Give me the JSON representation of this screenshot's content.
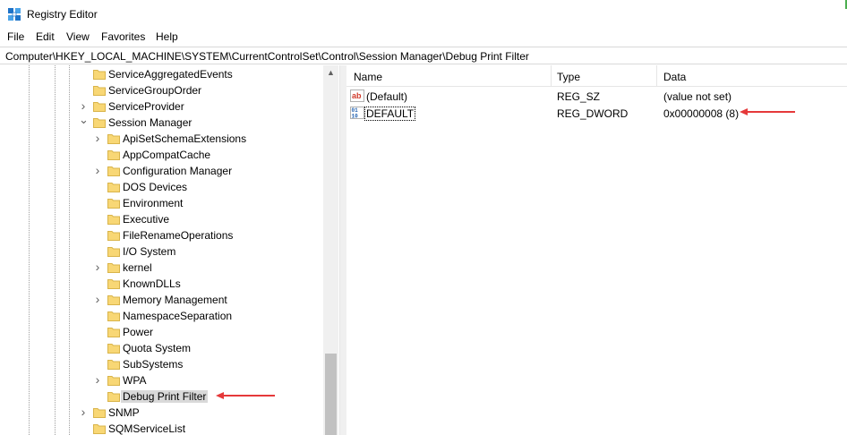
{
  "window": {
    "title": "Registry Editor"
  },
  "menu": [
    "File",
    "Edit",
    "View",
    "Favorites",
    "Help"
  ],
  "address": "Computer\\HKEY_LOCAL_MACHINE\\SYSTEM\\CurrentControlSet\\Control\\Session Manager\\Debug Print Filter",
  "tree": {
    "items": [
      {
        "label": "ServiceAggregatedEvents",
        "expander": ""
      },
      {
        "label": "ServiceGroupOrder",
        "expander": ""
      },
      {
        "label": "ServiceProvider",
        "expander": ">"
      },
      {
        "label": "Session Manager",
        "expander": "v"
      },
      {
        "label": "ApiSetSchemaExtensions",
        "expander": ">"
      },
      {
        "label": "AppCompatCache",
        "expander": ""
      },
      {
        "label": "Configuration Manager",
        "expander": ">"
      },
      {
        "label": "DOS Devices",
        "expander": ""
      },
      {
        "label": "Environment",
        "expander": ""
      },
      {
        "label": "Executive",
        "expander": ""
      },
      {
        "label": "FileRenameOperations",
        "expander": ""
      },
      {
        "label": "I/O System",
        "expander": ""
      },
      {
        "label": "kernel",
        "expander": ">"
      },
      {
        "label": "KnownDLLs",
        "expander": ""
      },
      {
        "label": "Memory Management",
        "expander": ">"
      },
      {
        "label": "NamespaceSeparation",
        "expander": ""
      },
      {
        "label": "Power",
        "expander": ""
      },
      {
        "label": "Quota System",
        "expander": ""
      },
      {
        "label": "SubSystems",
        "expander": ""
      },
      {
        "label": "WPA",
        "expander": ">"
      },
      {
        "label": "Debug Print Filter",
        "expander": "",
        "selected": true
      },
      {
        "label": "SNMP",
        "expander": ">"
      },
      {
        "label": "SQMServiceList",
        "expander": ""
      }
    ]
  },
  "values": {
    "columns": {
      "name": "Name",
      "type": "Type",
      "data": "Data"
    },
    "rows": [
      {
        "name": "(Default)",
        "type": "REG_SZ",
        "data": "(value not set)",
        "icon": "string-value-icon"
      },
      {
        "name": "DEFAULT",
        "type": "REG_DWORD",
        "data": "0x00000008 (8)",
        "icon": "binary-value-icon"
      }
    ]
  },
  "colors": {
    "annotation_arrow": "#e5393a",
    "folder": "#f8d775",
    "selection": "#d9d9d9"
  }
}
